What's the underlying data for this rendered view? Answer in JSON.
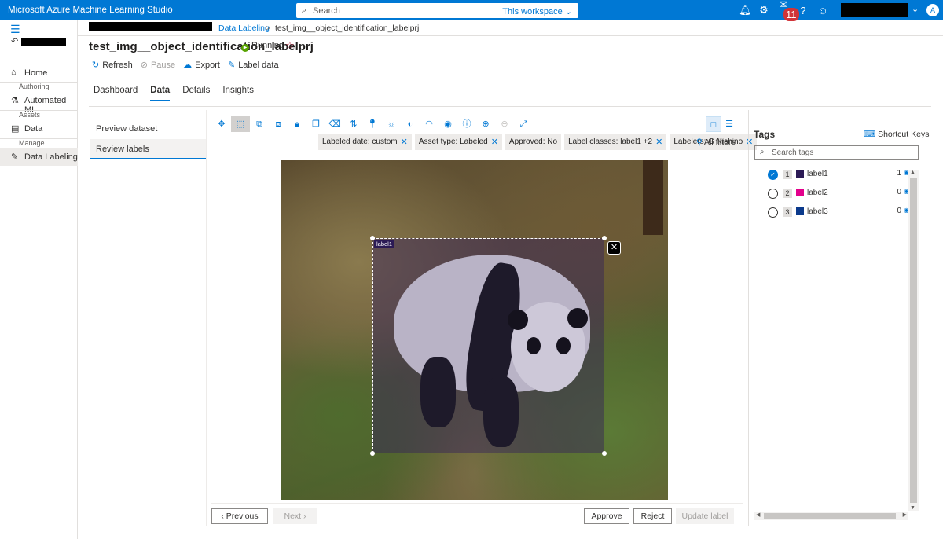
{
  "topbar": {
    "app_title": "Microsoft Azure Machine Learning Studio",
    "search_placeholder": "Search",
    "search_scope": "This workspace",
    "notifications_count": "11",
    "avatar_initial": "A"
  },
  "leftnav": {
    "home": "Home",
    "section_authoring": "Authoring",
    "automated_ml": "Automated ML",
    "section_assets": "Assets",
    "data": "Data",
    "section_manage": "Manage",
    "data_labeling": "Data Labeling"
  },
  "breadcrumb": {
    "link": "Data Labeling",
    "separator": ">",
    "current": "test_img__object_identification_labelprj"
  },
  "page": {
    "title": "test_img__object_identification_labelprj",
    "status": "Running"
  },
  "actions": {
    "refresh": "Refresh",
    "pause": "Pause",
    "export": "Export",
    "label_data": "Label data"
  },
  "tabs": [
    "Dashboard",
    "Data",
    "Details",
    "Insights"
  ],
  "subnav": {
    "preview": "Preview dataset",
    "review": "Review labels"
  },
  "filters": [
    "Labeled date: custom",
    "Asset type: Labeled",
    "Approved: No",
    "Label classes: label1 +2",
    "Labelers: G Nishino"
  ],
  "all_filters": "All filters",
  "bbox_label": "label1",
  "buttons": {
    "previous": "Previous",
    "next": "Next",
    "approve": "Approve",
    "reject": "Reject",
    "update_label": "Update label"
  },
  "tags_panel": {
    "title": "Tags",
    "shortcut_keys": "Shortcut Keys",
    "search_placeholder": "Search tags",
    "tags": [
      {
        "key": "1",
        "name": "label1",
        "count": "1",
        "color": "#2b1a55",
        "selected": true
      },
      {
        "key": "2",
        "name": "label2",
        "count": "0",
        "color": "#e3008c",
        "selected": false
      },
      {
        "key": "3",
        "name": "label3",
        "count": "0",
        "color": "#0b3a8c",
        "selected": false
      }
    ]
  }
}
